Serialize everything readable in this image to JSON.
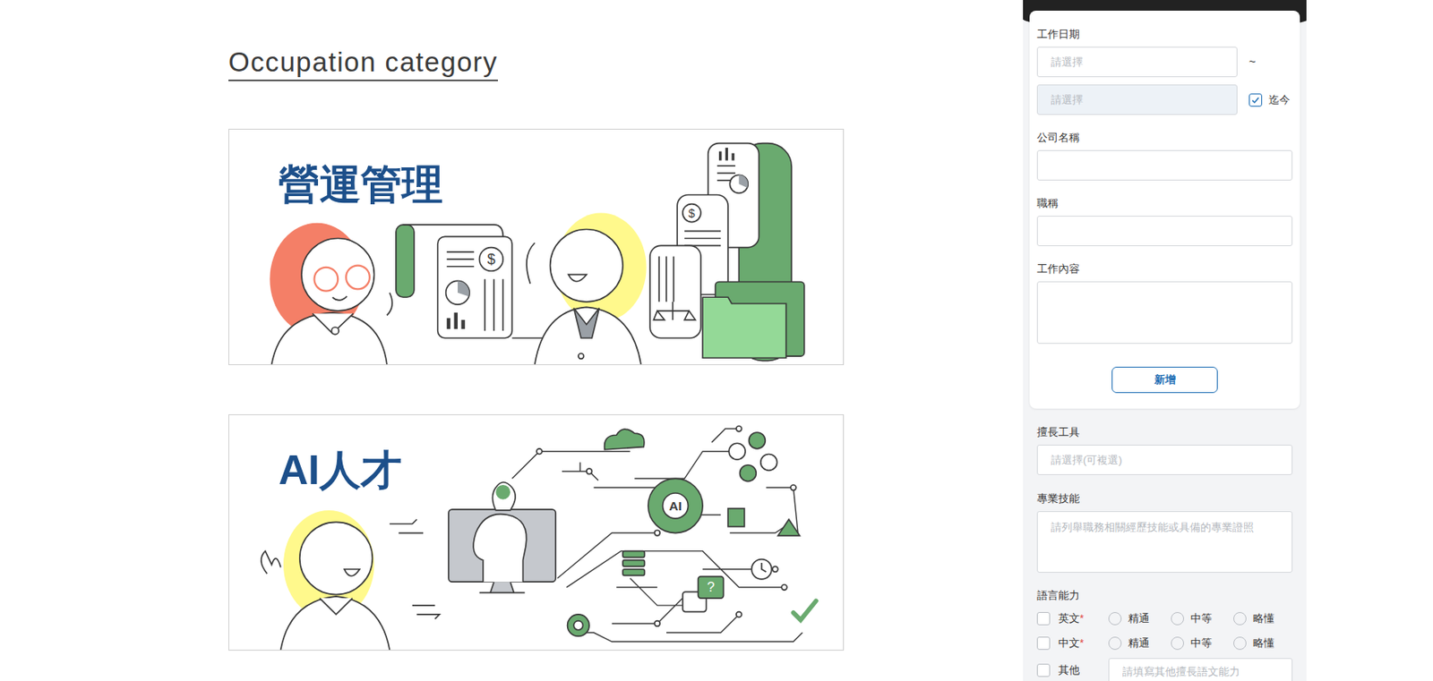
{
  "heading": "Occupation category",
  "categories": [
    {
      "title": "營運管理",
      "glyphs": [
        "$",
        "$"
      ]
    },
    {
      "title": "AI人才",
      "glyphs": [
        "AI",
        "?"
      ]
    }
  ],
  "form": {
    "date": {
      "label": "工作日期",
      "start_placeholder": "請選擇",
      "separator": "~",
      "end_placeholder": "請選擇",
      "end_disabled": true,
      "until_now": {
        "label": "迄今",
        "checked": true
      }
    },
    "fields": [
      {
        "label": "公司名稱",
        "kind": "input"
      },
      {
        "label": "職稱",
        "kind": "input"
      },
      {
        "label": "工作內容",
        "kind": "textarea"
      }
    ],
    "add_button": "新增"
  },
  "tools": {
    "label": "擅長工具",
    "placeholder": "請選擇(可複選)"
  },
  "skills": {
    "label": "專業技能",
    "placeholder": "請列舉職務相關經歷技能或具備的專業證照"
  },
  "languages": {
    "label": "語言能力",
    "required_mark": "*",
    "rows": [
      {
        "name": "英文",
        "required": true,
        "checked": false,
        "kind": "levels",
        "levels": [
          {
            "label": "精通",
            "selected": false
          },
          {
            "label": "中等",
            "selected": false
          },
          {
            "label": "略懂",
            "selected": false
          }
        ]
      },
      {
        "name": "中文",
        "required": true,
        "checked": false,
        "kind": "levels",
        "levels": [
          {
            "label": "精通",
            "selected": false
          },
          {
            "label": "中等",
            "selected": false
          },
          {
            "label": "略懂",
            "selected": false
          }
        ]
      },
      {
        "name": "其他",
        "required": false,
        "checked": false,
        "kind": "text",
        "placeholder": "請填寫其他擅長語文能力"
      }
    ]
  }
}
